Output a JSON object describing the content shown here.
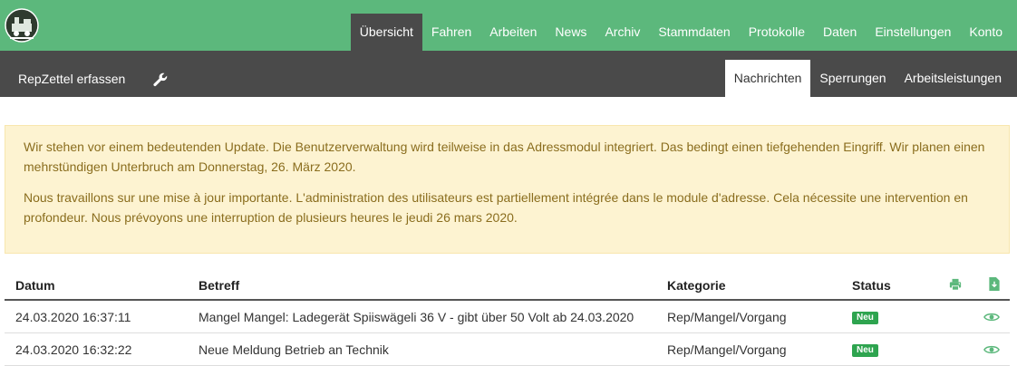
{
  "topnav": {
    "items": [
      "Übersicht",
      "Fahren",
      "Arbeiten",
      "News",
      "Archiv",
      "Stammdaten",
      "Protokolle",
      "Daten",
      "Einstellungen",
      "Konto"
    ],
    "active_index": 0
  },
  "subbar": {
    "left_label": "RepZettel erfassen",
    "tabs": [
      "Nachrichten",
      "Sperrungen",
      "Arbeitsleistungen"
    ],
    "active_index": 0
  },
  "alert": {
    "paragraph_de": "Wir stehen vor einem bedeutenden Update. Die Benutzerverwaltung wird teilweise in das Adressmodul integriert. Das bedingt einen tiefgehenden Eingriff. Wir planen einen mehrstündigen Unterbruch am Donnerstag, 26. März 2020.",
    "paragraph_fr": "Nous travaillons sur une mise à jour importante. L'administration des utilisateurs est partiellement intégrée dans le module d'adresse. Cela nécessite une intervention en profondeur. Nous prévoyons une interruption de plusieurs heures le jeudi 26 mars 2020."
  },
  "table": {
    "headers": {
      "date": "Datum",
      "subject": "Betreff",
      "category": "Kategorie",
      "status": "Status"
    },
    "rows": [
      {
        "date": "24.03.2020 16:37:11",
        "subject": "Mangel Mangel: Ladegerät Spiiswägeli 36 V - gibt über 50 Volt ab 24.03.2020",
        "category": "Rep/Mangel/Vorgang",
        "status": "Neu"
      },
      {
        "date": "24.03.2020 16:32:22",
        "subject": "Neue Meldung Betrieb an Technik",
        "category": "Rep/Mangel/Vorgang",
        "status": "Neu"
      }
    ]
  },
  "icons": {
    "logo": "locomotive-logo",
    "wrench": "wrench-icon",
    "print": "print-icon",
    "download": "download-icon",
    "view": "eye-icon"
  },
  "colors": {
    "topbar": "#5cb87c",
    "subbar": "#4a4a4a",
    "alert_bg": "#fdf3d1",
    "alert_text": "#8a6d1e",
    "badge": "#2ea44f",
    "icon_green": "#5cb87c"
  }
}
